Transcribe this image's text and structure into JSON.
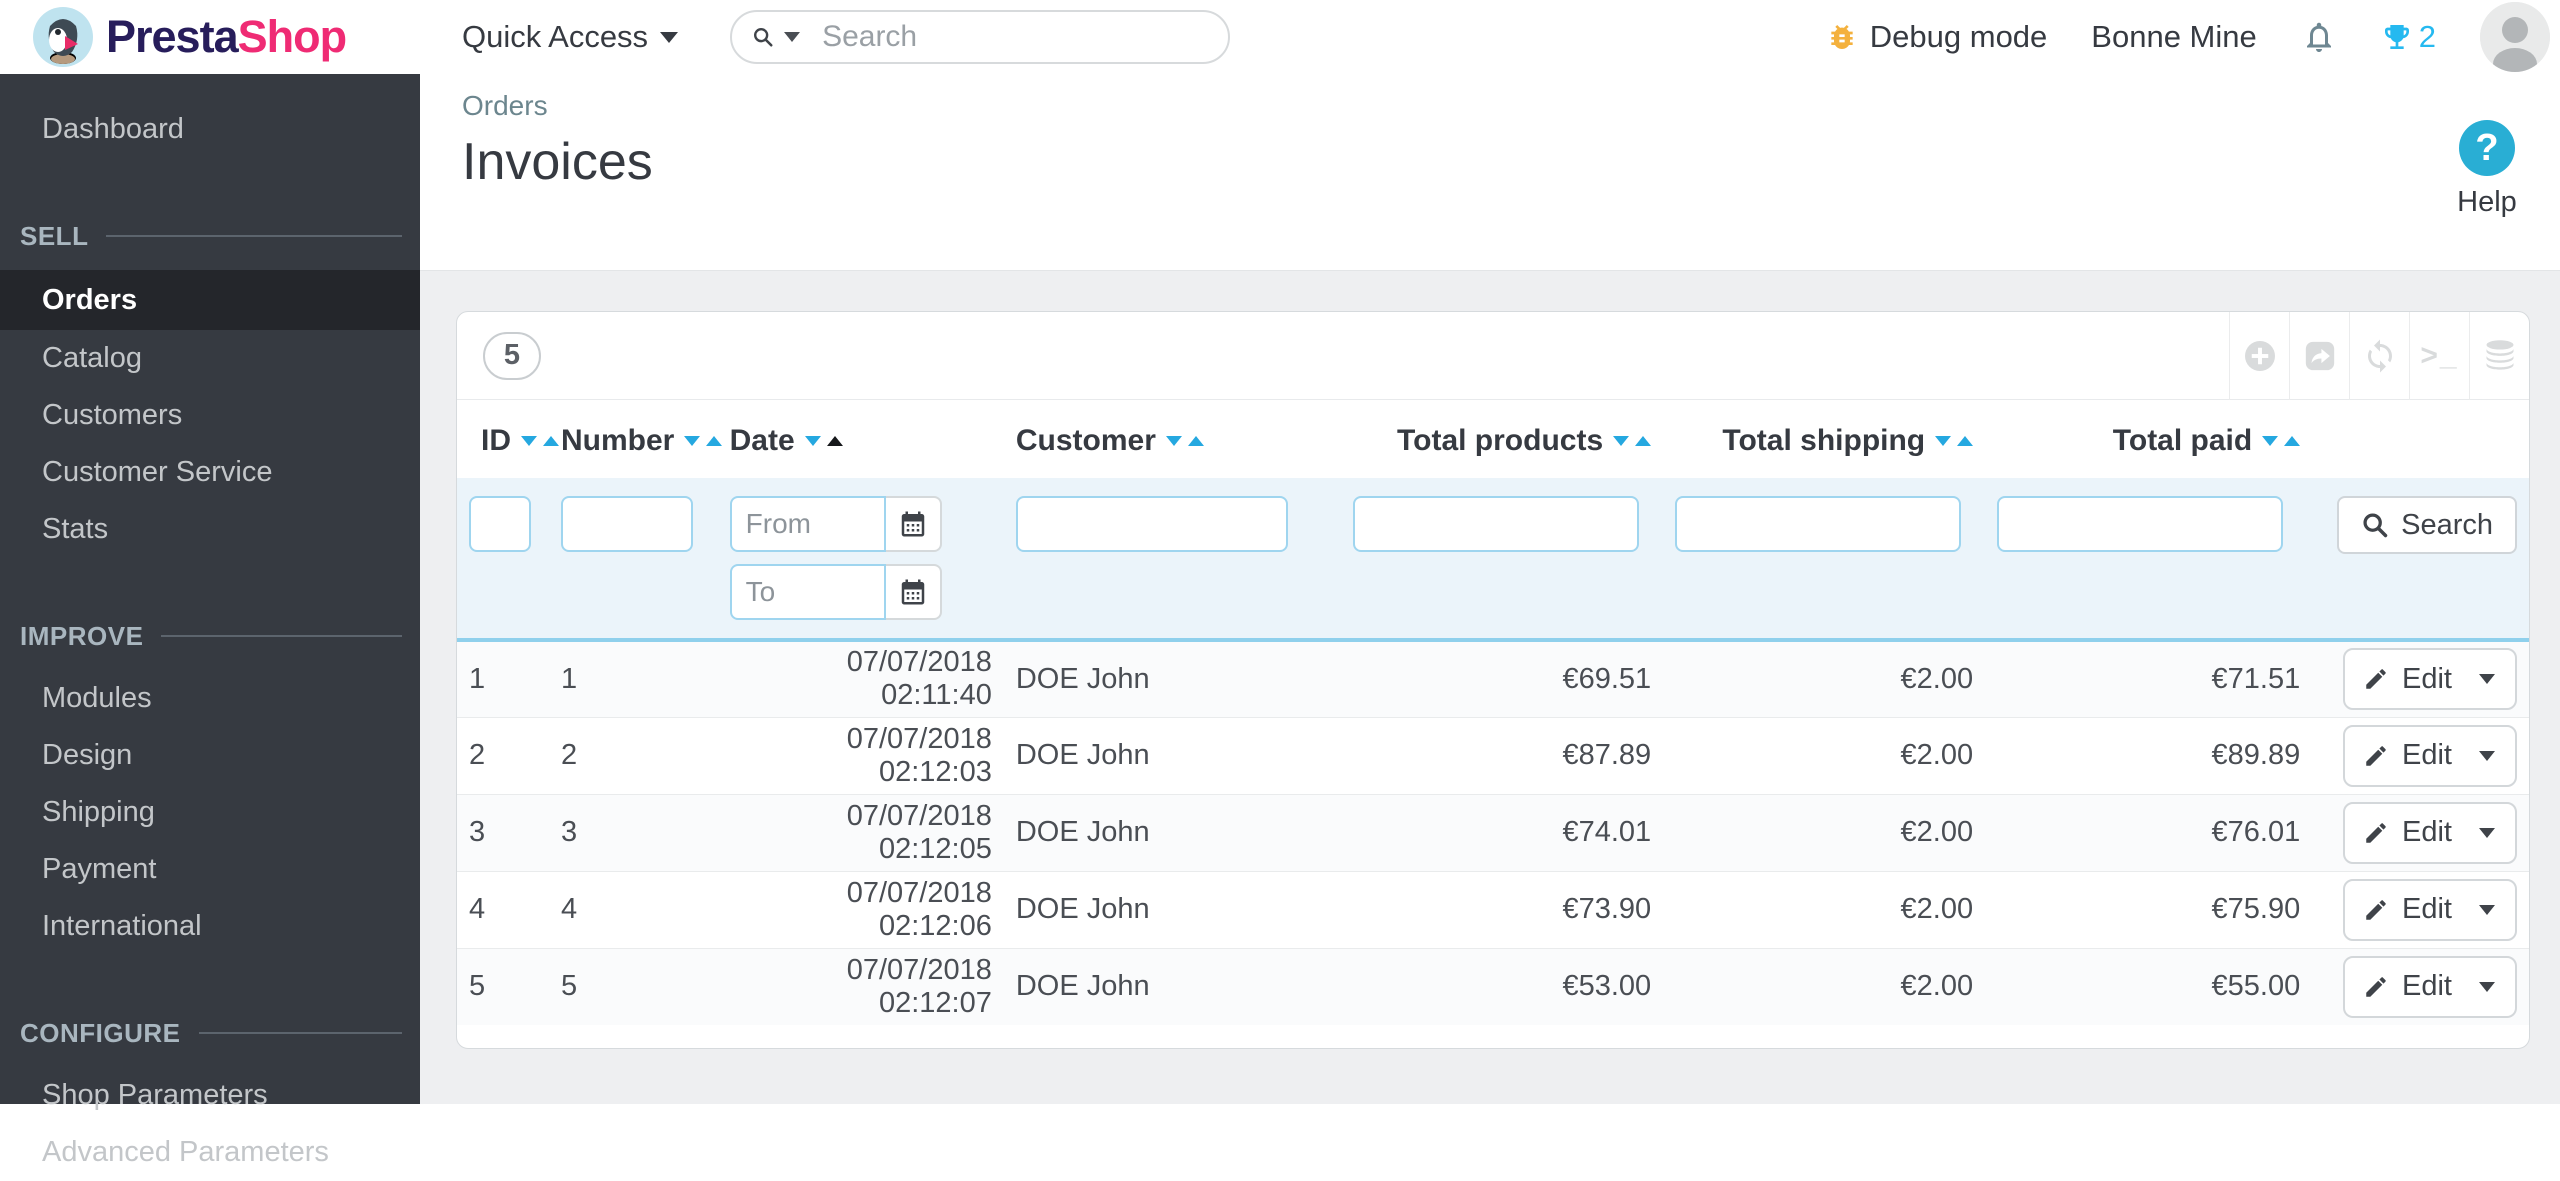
{
  "topbar": {
    "logo_presta": "Presta",
    "logo_shop": "Shop",
    "quick_access_label": "Quick Access",
    "search_placeholder": "Search",
    "debug_label": "Debug mode",
    "shop_name": "Bonne Mine",
    "achievement_count": "2"
  },
  "breadcrumb": "Orders",
  "page_title": "Invoices",
  "help_label": "Help",
  "sidebar": {
    "dashboard_label": "Dashboard",
    "sections": [
      {
        "title": "SELL",
        "items": [
          {
            "label": "Orders",
            "active": true
          },
          {
            "label": "Catalog"
          },
          {
            "label": "Customers"
          },
          {
            "label": "Customer Service"
          },
          {
            "label": "Stats"
          }
        ]
      },
      {
        "title": "IMPROVE",
        "items": [
          {
            "label": "Modules"
          },
          {
            "label": "Design"
          },
          {
            "label": "Shipping"
          },
          {
            "label": "Payment"
          },
          {
            "label": "International"
          }
        ]
      },
      {
        "title": "CONFIGURE",
        "items": [
          {
            "label": "Shop Parameters"
          },
          {
            "label": "Advanced Parameters"
          }
        ]
      }
    ]
  },
  "panel": {
    "record_count": "5",
    "toolbar_icons": [
      "add",
      "export",
      "refresh",
      "sql-query",
      "sql-manager"
    ]
  },
  "table": {
    "headers": [
      "ID",
      "Number",
      "Date",
      "Customer",
      "Total products",
      "Total shipping",
      "Total paid"
    ],
    "sorted_column": "Date",
    "sort_direction": "asc",
    "filter": {
      "from_placeholder": "From",
      "to_placeholder": "To",
      "search_label": "Search"
    },
    "edit_label": "Edit",
    "rows": [
      {
        "id": "1",
        "number": "1",
        "date": "07/07/2018 02:11:40",
        "customer": "DOE John",
        "total_products": "€69.51",
        "total_shipping": "€2.00",
        "total_paid": "€71.51"
      },
      {
        "id": "2",
        "number": "2",
        "date": "07/07/2018 02:12:03",
        "customer": "DOE John",
        "total_products": "€87.89",
        "total_shipping": "€2.00",
        "total_paid": "€89.89"
      },
      {
        "id": "3",
        "number": "3",
        "date": "07/07/2018 02:12:05",
        "customer": "DOE John",
        "total_products": "€74.01",
        "total_shipping": "€2.00",
        "total_paid": "€76.01"
      },
      {
        "id": "4",
        "number": "4",
        "date": "07/07/2018 02:12:06",
        "customer": "DOE John",
        "total_products": "€73.90",
        "total_shipping": "€2.00",
        "total_paid": "€75.90"
      },
      {
        "id": "5",
        "number": "5",
        "date": "07/07/2018 02:12:07",
        "customer": "DOE John",
        "total_products": "€53.00",
        "total_shipping": "€2.00",
        "total_paid": "€55.00"
      }
    ]
  },
  "colors": {
    "logo_navy": "#271d5b",
    "logo_pink": "#ef2b74",
    "sidebar_bg": "#363a41",
    "sidebar_active_bg": "#24262b",
    "sort_arrow_blue": "#25a8e0",
    "filter_bg": "#ebf4fa",
    "filter_border_blue": "#8fd0ec",
    "help_circle_blue": "#29aed4",
    "trophy_blue": "#25b9f0",
    "debug_bug_yellow": "#f4b13d",
    "content_gray": "#eeeff1"
  }
}
